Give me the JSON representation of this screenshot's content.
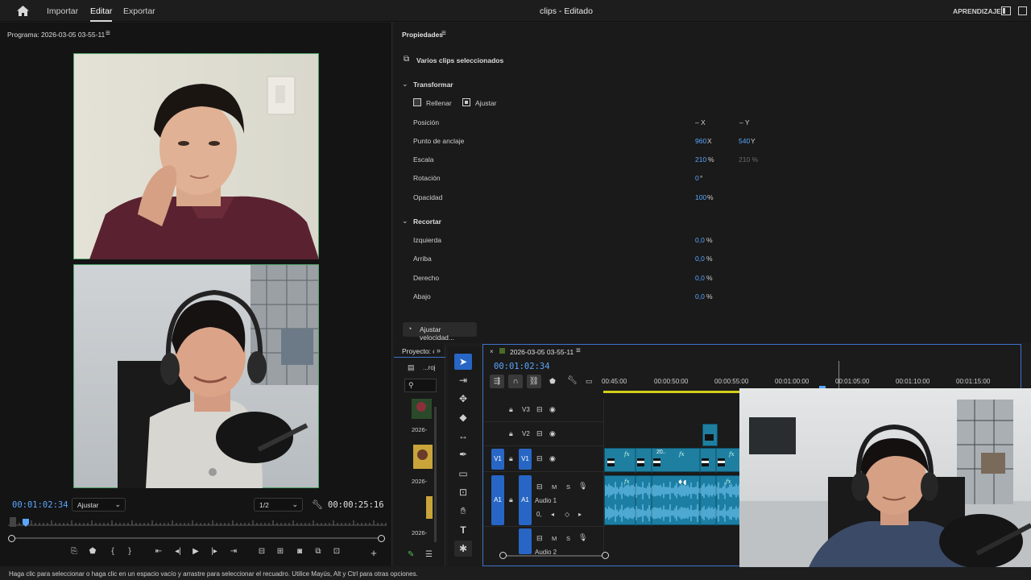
{
  "topbar": {
    "menu": [
      "Importar",
      "Editar",
      "Exportar"
    ],
    "active": "Editar",
    "title": "clips - Editado",
    "learn": "APRENDIZAJE"
  },
  "program": {
    "title": "Programa: 2026-03-05 03-55-11",
    "timecode": "00:01:02:34",
    "fit_label": "Ajustar",
    "resolution": "1/2",
    "duration": "00:00:25:16"
  },
  "properties": {
    "title": "Propiedades",
    "selection": "Varios clips seleccionados",
    "transform_label": "Transformar",
    "fill_label": "Rellenar",
    "fit_label": "Ajustar",
    "position": {
      "label": "Posición",
      "x": "– X",
      "y": "– Y"
    },
    "anchor": {
      "label": "Punto de anclaje",
      "x": "960",
      "x_unit": "X",
      "y": "540",
      "y_unit": "Y"
    },
    "scale": {
      "label": "Escala",
      "value": "210",
      "unit": "%",
      "dim": "210 %"
    },
    "rotation": {
      "label": "Rotación",
      "value": "0",
      "unit": "°"
    },
    "opacity": {
      "label": "Opacidad",
      "value": "100",
      "unit": "%"
    },
    "crop_label": "Recortar",
    "crop": [
      {
        "label": "Izquierda",
        "value": "0,0",
        "unit": "%"
      },
      {
        "label": "Arriba",
        "value": "0,0",
        "unit": "%"
      },
      {
        "label": "Derecho",
        "value": "0,0",
        "unit": "%"
      },
      {
        "label": "Abajo",
        "value": "0,0",
        "unit": "%"
      }
    ],
    "speed_button": "Ajustar velocidad..."
  },
  "project": {
    "title": "Proyecto: c",
    "item1": "...roj",
    "dates": [
      "2026-",
      "2026-",
      "2026-"
    ]
  },
  "timeline": {
    "title": "2026-03-05 03-55-11",
    "timecode": "00:01:02:34",
    "ruler": [
      "00:45:00",
      "00:00:50:00",
      "00:00:55:00",
      "00:01:00:00",
      "00:01:05:00",
      "00:01:10:00",
      "00:01:15:00"
    ],
    "tracks": {
      "v3": "V3",
      "v2": "V2",
      "v1": "V1",
      "v1_src": "V1",
      "a1": "A1",
      "a1_src": "A1",
      "a1_name": "Audio 1",
      "a2_name": "Audio 2",
      "m": "M",
      "s": "S",
      "level": "0,"
    },
    "clip_label": "20.."
  },
  "status": "Haga clic para seleccionar o haga clic en un espacio vacío y arrastre para seleccionar el recuadro. Utilice Mayús, Alt y Ctrl para otras opciones.",
  "colors": {
    "accent": "#2766c5",
    "timecode": "#5aa6ff",
    "clip": "#1f7fa0"
  }
}
